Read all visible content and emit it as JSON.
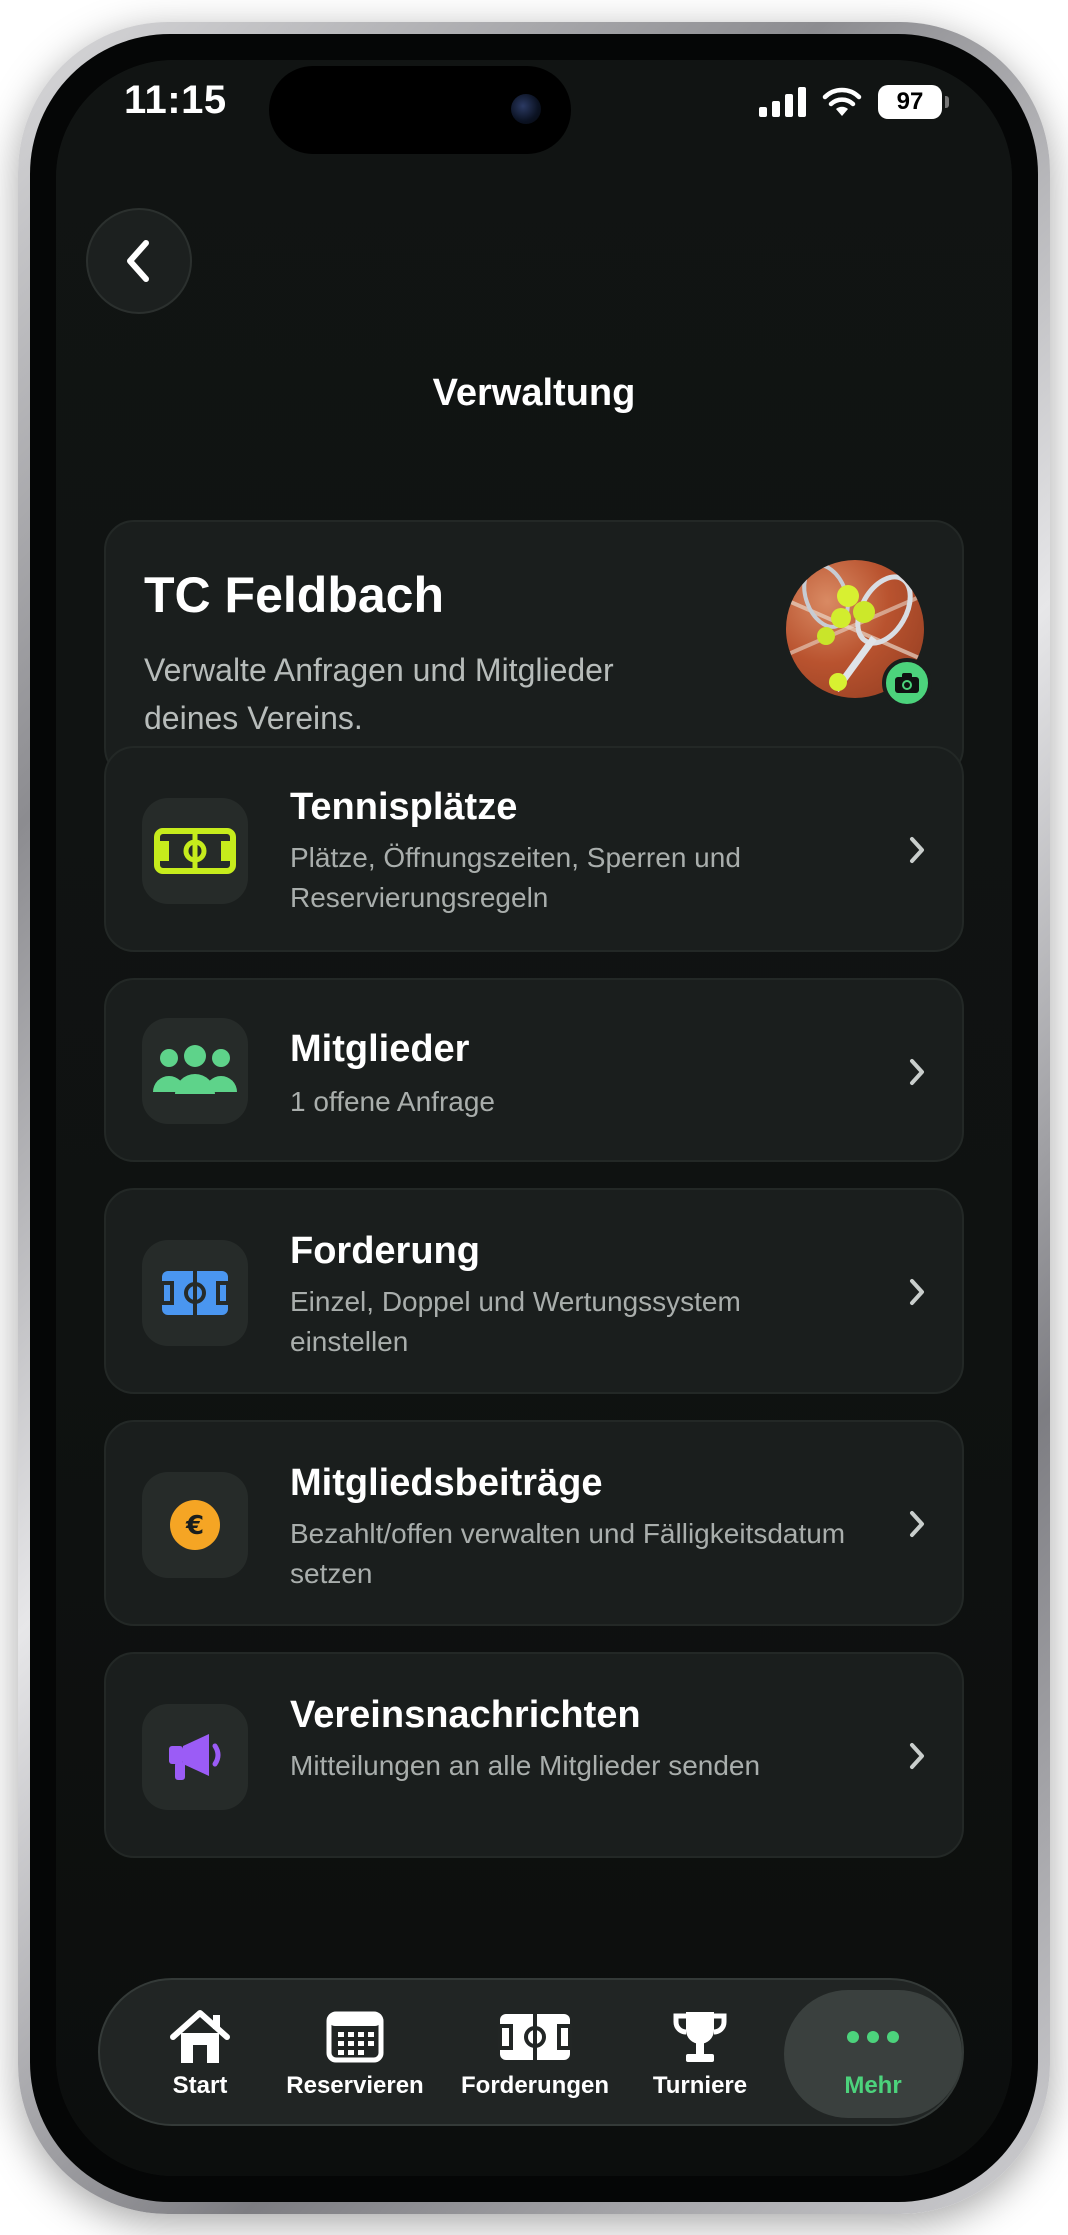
{
  "status_bar": {
    "time": "11:15",
    "battery": "97"
  },
  "header": {
    "title": "Verwaltung"
  },
  "club": {
    "name": "TC Feldbach",
    "description": "Verwalte Anfragen und Mitglieder deines Vereins."
  },
  "menu": [
    {
      "title": "Tennisplätze",
      "subtitle": "Plätze, Öffnungszeiten, Sperren und Reservierungsregeln",
      "icon": "court-icon",
      "color": "#c6ec1c"
    },
    {
      "title": "Mitglieder",
      "subtitle": "1 offene Anfrage",
      "icon": "users-icon",
      "color": "#5ed38a"
    },
    {
      "title": "Forderung",
      "subtitle": "Einzel, Doppel und Wertungssystem einstellen",
      "icon": "court-icon",
      "color": "#4a96f0"
    },
    {
      "title": "Mitgliedsbeiträge",
      "subtitle": "Bezahlt/offen verwalten und Fälligkeitsdatum setzen",
      "icon": "euro-icon",
      "color": "#f5a524"
    },
    {
      "title": "Vereinsnachrichten",
      "subtitle": "Mitteilungen an alle Mitglieder senden",
      "icon": "megaphone-icon",
      "color": "#9b5cf6"
    }
  ],
  "tabs": [
    {
      "label": "Start",
      "icon": "home-icon"
    },
    {
      "label": "Reservieren",
      "icon": "calendar-icon"
    },
    {
      "label": "Forderungen",
      "icon": "court-icon"
    },
    {
      "label": "Turniere",
      "icon": "trophy-icon"
    },
    {
      "label": "Mehr",
      "icon": "more-icon",
      "active": true
    }
  ],
  "colors": {
    "accent": "#4cd37c",
    "card": "#1a1e1d",
    "background": "#0e1110"
  }
}
